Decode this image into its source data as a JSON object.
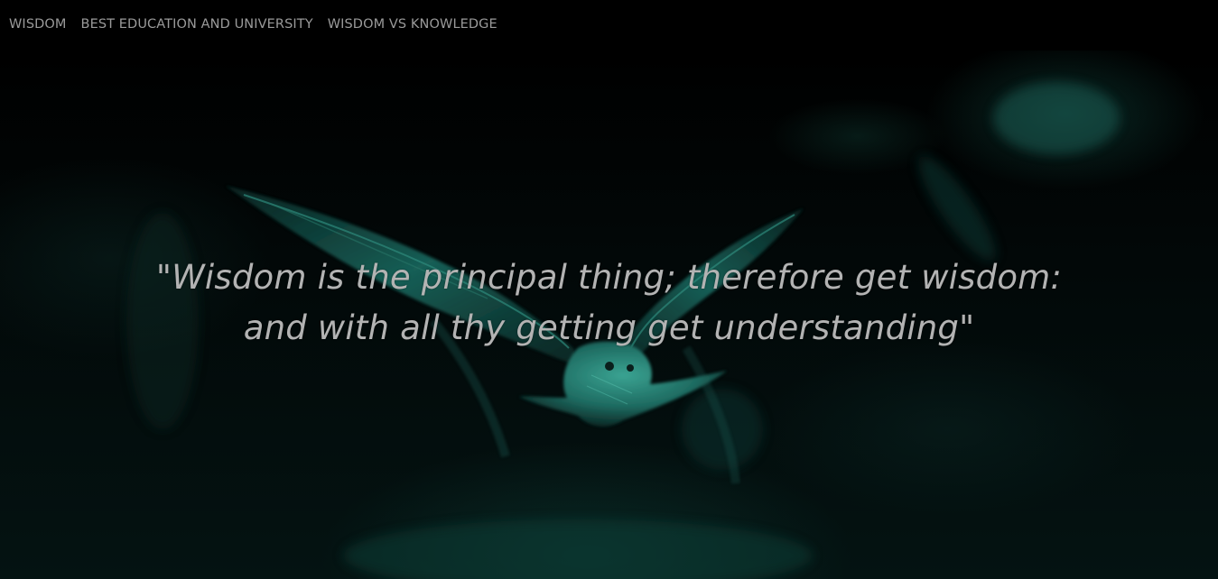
{
  "nav": {
    "items": [
      {
        "label": "WISDOM"
      },
      {
        "label": "BEST EDUCATION AND UNIVERSITY"
      },
      {
        "label": "WISDOM VS KNOWLEDGE"
      }
    ]
  },
  "hero": {
    "quote_line1": "\"Wisdom is the principal thing; therefore get wisdom:",
    "quote_line2": "and with all thy getting get understanding\"",
    "background_image": "teal-owl-in-flight",
    "accent_color": "#1c7a6e"
  }
}
